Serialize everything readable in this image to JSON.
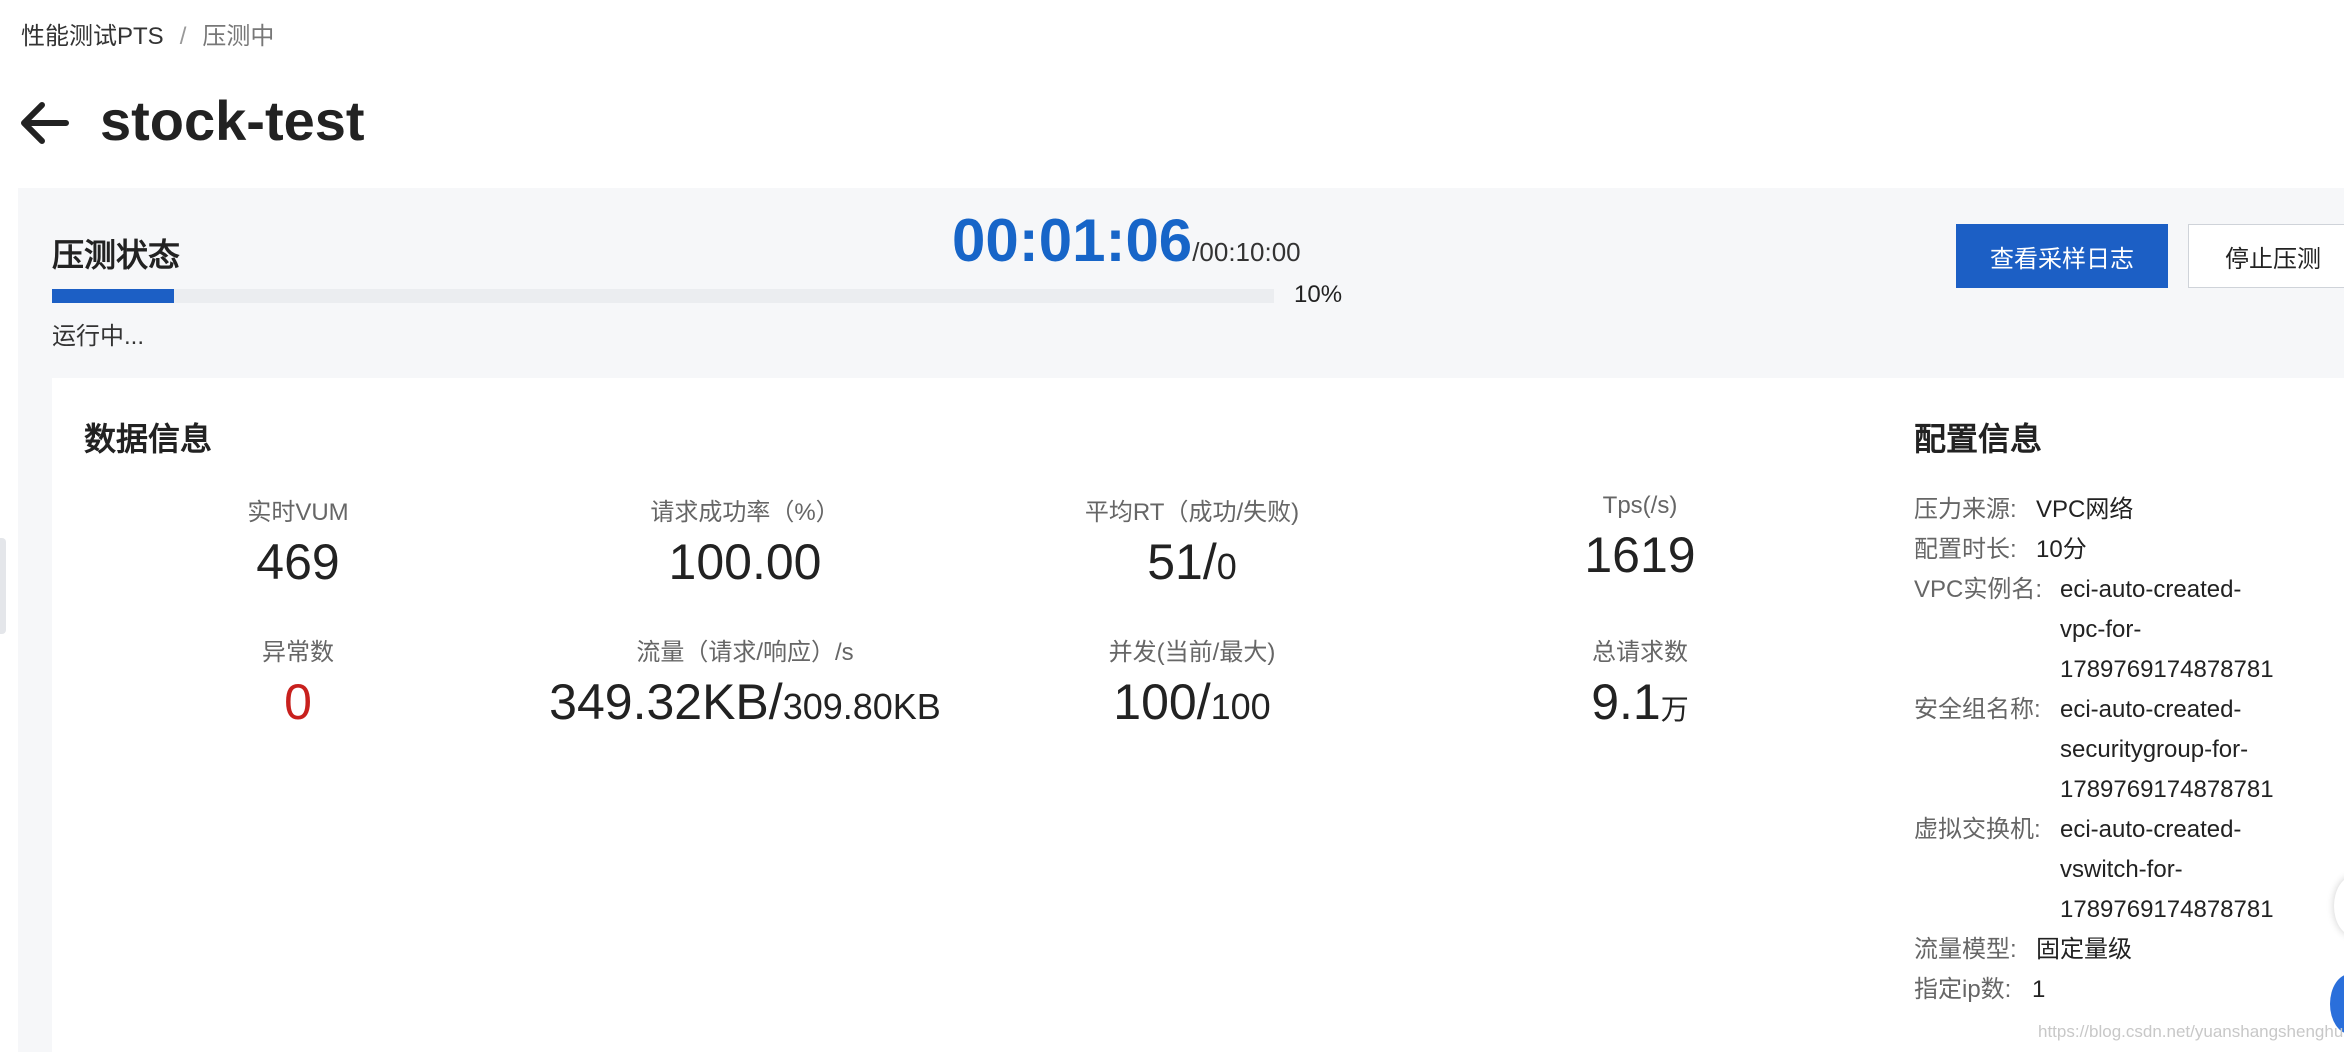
{
  "breadcrumb": {
    "root": "性能测试PTS",
    "separator": "/",
    "current": "压测中"
  },
  "page": {
    "title": "stock-test"
  },
  "status": {
    "title": "压测状态",
    "elapsed": "00:01:06",
    "total": "/00:10:00",
    "progress_percent": 10,
    "progress_label": "10%",
    "state": "运行中..."
  },
  "actions": {
    "view_log": "查看采样日志",
    "stop": "停止压测"
  },
  "data_info": {
    "title": "数据信息",
    "metrics": [
      {
        "label": "实时VUM",
        "value": "469"
      },
      {
        "label": "请求成功率（%）",
        "value": "100.00"
      },
      {
        "label": "平均RT（成功/失败)",
        "value_main": "51/",
        "value_small": "0"
      },
      {
        "label": "Tps(/s)",
        "value": "1619"
      },
      {
        "label": "异常数",
        "value": "0"
      },
      {
        "label": "流量（请求/响应）/s",
        "value_main": "349.32KB/",
        "value_small": "309.80KB"
      },
      {
        "label": "并发(当前/最大)",
        "value_main": "100/",
        "value_small": "100"
      },
      {
        "label": "总请求数",
        "value_main": "9.1",
        "value_unit": "万"
      }
    ]
  },
  "config_info": {
    "title": "配置信息",
    "rows": [
      {
        "label": "压力来源:",
        "value": "VPC网络"
      },
      {
        "label": "配置时长:",
        "value": "10分"
      },
      {
        "label": "VPC实例名:",
        "lines": [
          "eci-auto-created-",
          "vpc-for-",
          "1789769174878781"
        ]
      },
      {
        "label": "安全组名称:",
        "lines": [
          "eci-auto-created-",
          "securitygroup-for-",
          "1789769174878781"
        ]
      },
      {
        "label": "虚拟交换机:",
        "lines": [
          "eci-auto-created-",
          "vswitch-for-",
          "1789769174878781"
        ]
      },
      {
        "label": "流量模型:",
        "value": "固定量级"
      },
      {
        "label": "指定ip数:",
        "value": "1"
      }
    ]
  },
  "watermark": "https://blog.csdn.net/yuanshangshenghuo",
  "colors": {
    "accent": "#1c5fc5",
    "timer": "#1765c8",
    "error": "#c8201d",
    "panel": "#f6f7f9"
  },
  "icons": {
    "back": "arrow-left-icon"
  }
}
